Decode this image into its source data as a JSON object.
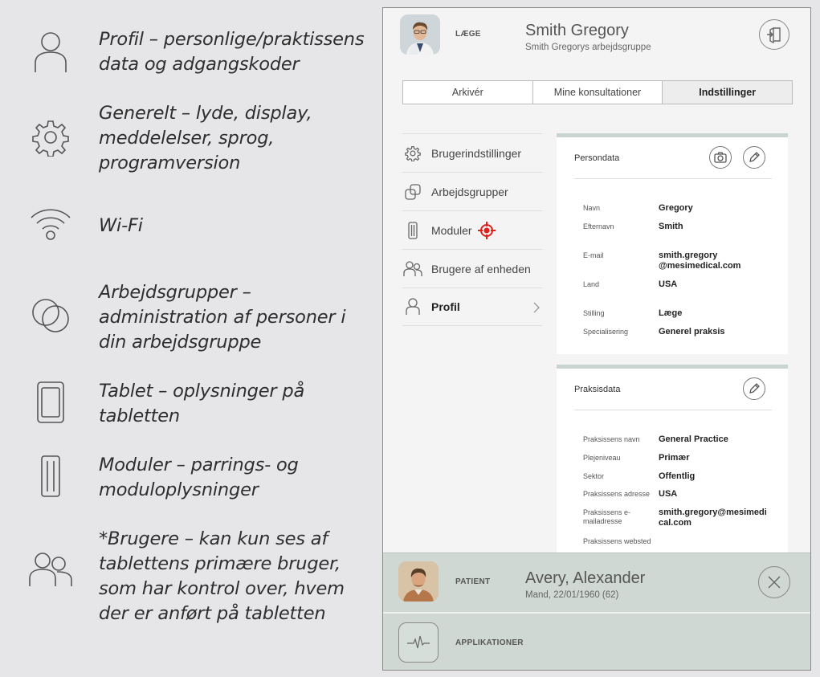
{
  "legend": [
    {
      "icon": "person-icon",
      "text": "Profil – personlige/praktissens data og adgangskoder"
    },
    {
      "icon": "gear-icon",
      "text": "Generelt – lyde, display, meddelelser, sprog, programversion"
    },
    {
      "icon": "wifi-icon",
      "text": "Wi-Fi"
    },
    {
      "icon": "workgroups-icon",
      "text": "Arbejdsgrupper – administration af personer i din arbejdsgruppe"
    },
    {
      "icon": "tablet-icon",
      "text": "Tablet – oplysninger på tabletten"
    },
    {
      "icon": "module-icon",
      "text": "Moduler – parrings- og moduloplysninger"
    },
    {
      "icon": "users-icon",
      "text": "*Brugere – kan kun ses af tablettens primære bruger, som har kontrol over, hvem der er anført på tabletten"
    }
  ],
  "doctor": {
    "role": "LÆGE",
    "name": "Smith Gregory",
    "group": "Smith Gregorys arbejdsgruppe"
  },
  "tabs": [
    {
      "label": "Arkivér",
      "active": false
    },
    {
      "label": "Mine konsultationer",
      "active": false
    },
    {
      "label": "Indstillinger",
      "active": true
    }
  ],
  "menu": [
    {
      "icon": "gear-icon",
      "label": "Brugerindstillinger",
      "active": false
    },
    {
      "icon": "workgroups-icon",
      "label": "Arbejdsgrupper",
      "active": false
    },
    {
      "icon": "module-icon",
      "label": "Moduler",
      "active": false
    },
    {
      "icon": "users-icon",
      "label": "Brugere af enheden",
      "active": false
    },
    {
      "icon": "person-icon",
      "label": "Profil",
      "active": true
    }
  ],
  "persondata": {
    "title": "Persondata",
    "fields": [
      {
        "label": "Navn",
        "value": "Gregory"
      },
      {
        "label": "Efternavn",
        "value": "Smith"
      },
      {
        "label": "E-mail",
        "value": "smith.gregory\n@mesimedical.com"
      },
      {
        "label": "Land",
        "value": "USA"
      },
      {
        "label": "Stilling",
        "value": "Læge"
      },
      {
        "label": "Specialisering",
        "value": "Generel praksis"
      }
    ]
  },
  "praksisdata": {
    "title": "Praksisdata",
    "fields": [
      {
        "label": "Praksissens navn",
        "value": "General Practice"
      },
      {
        "label": "Plejeniveau",
        "value": "Primær"
      },
      {
        "label": "Sektor",
        "value": "Offentlig"
      },
      {
        "label": "Praksissens adresse",
        "value": "USA"
      },
      {
        "label": "Praksissens e-mailadresse",
        "value": "smith.gregory@mesimedi\ncal.com"
      },
      {
        "label": "Praksissens websted",
        "value": ""
      }
    ]
  },
  "patient": {
    "role": "PATIENT",
    "name": "Avery, Alexander",
    "details": "Mand, 22/01/1960 (62)"
  },
  "apps": {
    "label": "APPLIKATIONER"
  },
  "colors": {
    "accent_bar": "#cfd8d3",
    "card_top": "#c9d4cf",
    "module_target": "#e0201b"
  }
}
